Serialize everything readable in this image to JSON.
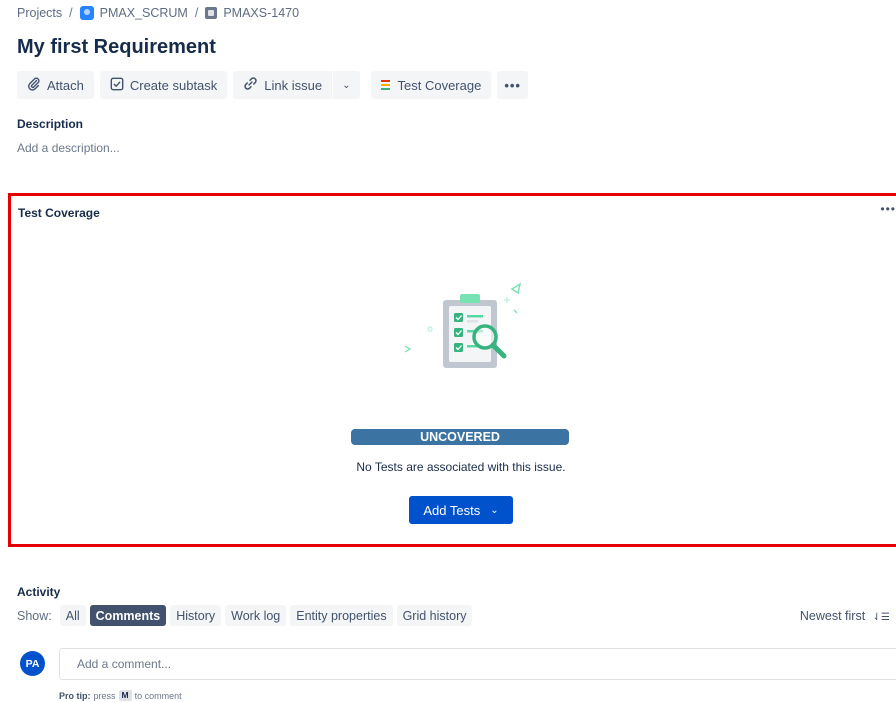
{
  "breadcrumb": {
    "projects": "Projects",
    "separator": "/",
    "project": "PMAX_SCRUM",
    "issue": "PMAXS-1470"
  },
  "issue": {
    "title": "My first Requirement"
  },
  "toolbar": {
    "attach": "Attach",
    "create_subtask": "Create subtask",
    "link_issue": "Link issue",
    "test_coverage": "Test Coverage",
    "more": "•••"
  },
  "description": {
    "label": "Description",
    "placeholder": "Add a description..."
  },
  "test_coverage_panel": {
    "title": "Test Coverage",
    "more": "•••",
    "status": "UNCOVERED",
    "message": "No Tests are associated with this issue.",
    "add_tests_button": "Add Tests",
    "status_color": "#3b73a3"
  },
  "activity": {
    "label": "Activity",
    "show_label": "Show:",
    "filters": [
      "All",
      "Comments",
      "History",
      "Work log",
      "Entity properties",
      "Grid history"
    ],
    "active_filter": "Comments",
    "sort": "Newest first",
    "avatar_initials": "PA",
    "comment_placeholder": "Add a comment...",
    "pro_tip_prefix": "Pro tip:",
    "pro_tip_press": "press",
    "pro_tip_key": "M",
    "pro_tip_suffix": "to comment"
  },
  "colors": {
    "accent": "#0052cc",
    "highlight_border": "#e50000"
  },
  "icons": {
    "attach": "paperclip-icon",
    "subtask": "checkbox-icon",
    "link": "link-icon",
    "coverage": "coverage-bars-icon",
    "sort": "sort-icon"
  }
}
